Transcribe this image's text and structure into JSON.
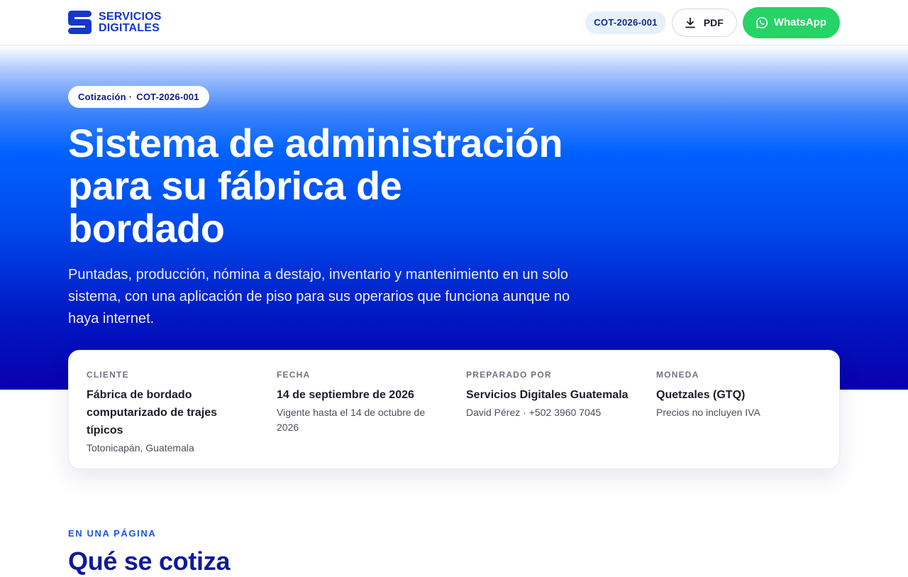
{
  "brand": {
    "line1": "SERVICIOS",
    "line2": "DIGITALES",
    "color": "#1238c9"
  },
  "header": {
    "quote_ref": "COT-2026-001",
    "pdf_label": "PDF",
    "pdf_icon": "download-icon",
    "whatsapp_label": "WhatsApp",
    "whatsapp_icon": "whatsapp-icon",
    "whatsapp_color": "#25d366"
  },
  "hero": {
    "pill_prefix": "Cotización",
    "pill_sep": "·",
    "pill_ref": "COT-2026-001",
    "title": "Sistema de administración para su fábrica de bordado",
    "subtitle": "Puntadas, producción, nómina a destajo, inventario y mantenimiento en un solo sistema, con una aplicación de piso para sus operarios que funciona aunque no haya internet."
  },
  "info": {
    "cliente": {
      "label": "CLIENTE",
      "main": "Fábrica de bordado computarizado de trajes típicos",
      "sub": "Totonicapán, Guatemala"
    },
    "fecha": {
      "label": "FECHA",
      "main": "14 de septiembre de 2026",
      "sub": "Vigente hasta el 14 de octubre de 2026"
    },
    "preparado": {
      "label": "PREPARADO POR",
      "main": "Servicios Digitales Guatemala",
      "sub": "David Pérez · +502 3960 7045"
    },
    "moneda": {
      "label": "MONEDA",
      "main": "Quetzales (GTQ)",
      "sub": "Precios no incluyen IVA"
    }
  },
  "section": {
    "eyebrow": "EN UNA PÁGINA",
    "title": "Qué se cotiza"
  }
}
